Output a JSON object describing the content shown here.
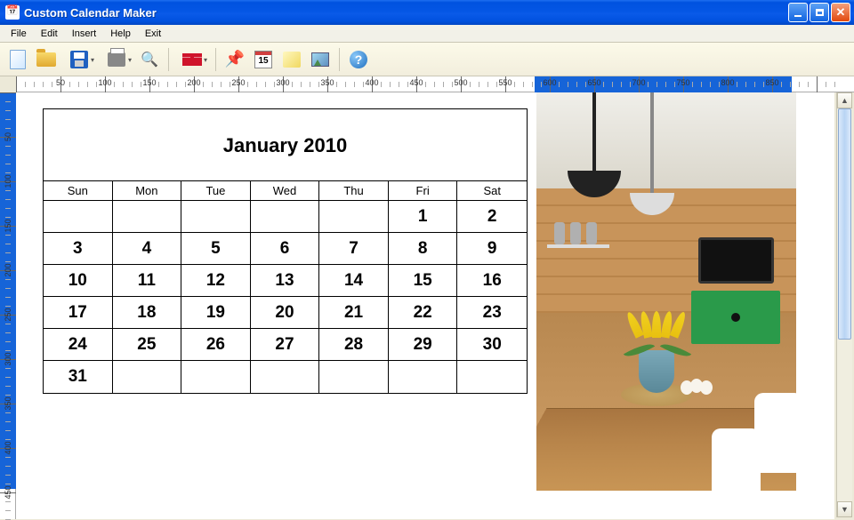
{
  "window": {
    "title": "Custom Calendar Maker"
  },
  "menu": {
    "file": "File",
    "edit": "Edit",
    "insert": "Insert",
    "help": "Help",
    "exit": "Exit"
  },
  "toolbar": {
    "cal_day": "15",
    "help_glyph": "?",
    "zoom_glyph": "🔍",
    "pin_glyph": "📌"
  },
  "ruler": {
    "marks": [
      "50",
      "100",
      "150",
      "200",
      "250",
      "300",
      "350",
      "400",
      "450",
      "500",
      "550",
      "600",
      "650",
      "700",
      "750",
      "800",
      "850"
    ],
    "h_sel_start": 583,
    "h_sel_end": 872,
    "v_marks": [
      "50",
      "100",
      "150",
      "200",
      "250",
      "300",
      "350",
      "400",
      "450"
    ],
    "v_sel_start": 0,
    "v_sel_end": 446
  },
  "calendar": {
    "title": "January 2010",
    "days": [
      "Sun",
      "Mon",
      "Tue",
      "Wed",
      "Thu",
      "Fri",
      "Sat"
    ],
    "weeks": [
      [
        "",
        "",
        "",
        "",
        "",
        "1",
        "2"
      ],
      [
        "3",
        "4",
        "5",
        "6",
        "7",
        "8",
        "9"
      ],
      [
        "10",
        "11",
        "12",
        "13",
        "14",
        "15",
        "16"
      ],
      [
        "17",
        "18",
        "19",
        "20",
        "21",
        "22",
        "23"
      ],
      [
        "24",
        "25",
        "26",
        "27",
        "28",
        "29",
        "30"
      ],
      [
        "31",
        "",
        "",
        "",
        "",
        "",
        ""
      ]
    ]
  }
}
